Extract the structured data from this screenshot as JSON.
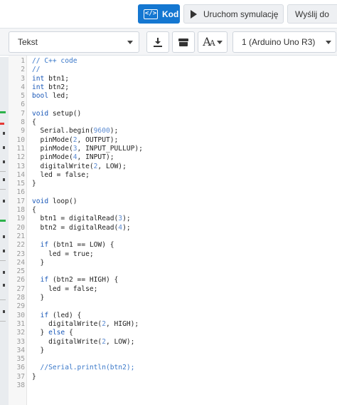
{
  "toolbar": {
    "code_label": "Kod",
    "code_icon_glyph": "</>",
    "simulate_label": "Uruchom symulację",
    "send_label": "Wyślij do"
  },
  "editor_toolbar": {
    "mode_select": "Tekst",
    "board_select": "1 (Arduino Uno R3)"
  },
  "colors": {
    "accent": "#1477d1",
    "comment": "#3a78c9",
    "keyword": "#1a58b8"
  },
  "code": {
    "lines": [
      "// C++ code",
      "//",
      "int btn1;",
      "int btn2;",
      "bool led;",
      "",
      "void setup()",
      "{",
      "  Serial.begin(9600);",
      "  pinMode(2, OUTPUT);",
      "  pinMode(3, INPUT_PULLUP);",
      "  pinMode(4, INPUT);",
      "  digitalWrite(2, LOW);",
      "  led = false;",
      "}",
      "",
      "void loop()",
      "{",
      "  btn1 = digitalRead(3);",
      "  btn2 = digitalRead(4);",
      "",
      "  if (btn1 == LOW) {",
      "    led = true;",
      "  }",
      "",
      "  if (btn2 == HIGH) {",
      "    led = false;",
      "  }",
      "",
      "  if (led) {",
      "    digitalWrite(2, HIGH);",
      "  } else {",
      "    digitalWrite(2, LOW);",
      "  }",
      "",
      "  //Serial.println(btn2);",
      "}",
      ""
    ]
  }
}
